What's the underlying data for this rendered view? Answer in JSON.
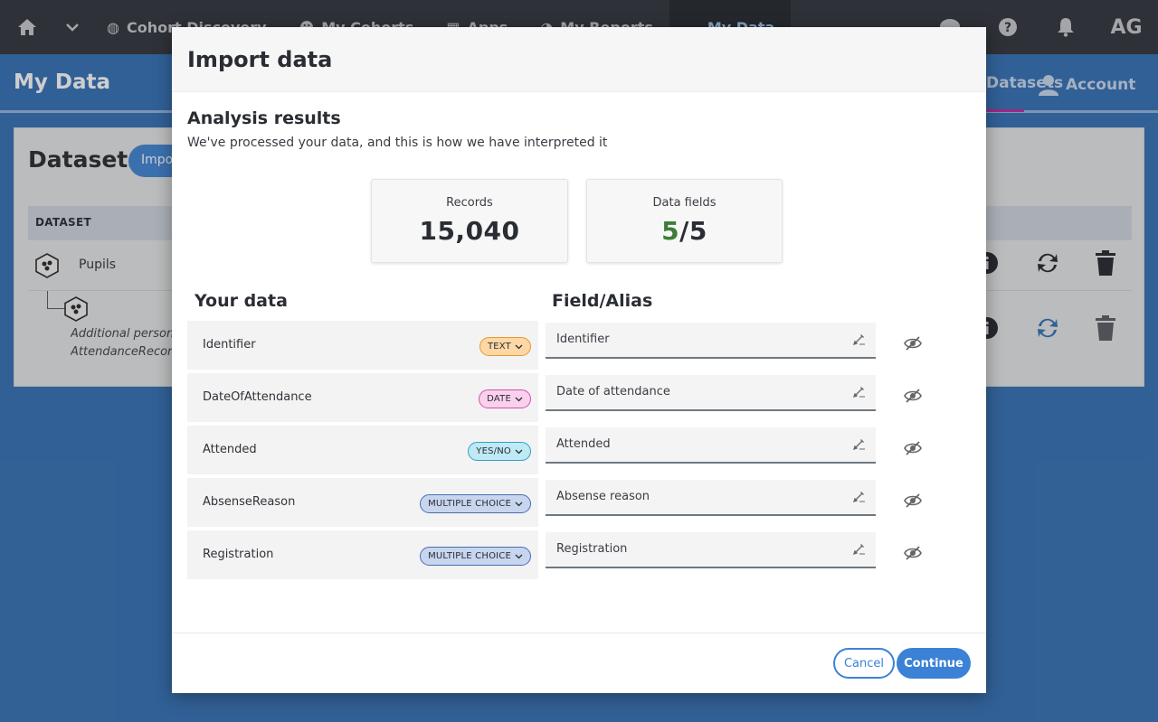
{
  "app": {
    "nav": {
      "items": [
        {
          "label": "Cohort Discovery",
          "icon": "cohort-icon"
        },
        {
          "label": "My Cohorts",
          "icon": "people-icon"
        },
        {
          "label": "Apps",
          "icon": "apps-icon"
        },
        {
          "label": "My Reports",
          "icon": "reports-icon"
        },
        {
          "label": "My Data",
          "icon": "cloud-icon",
          "active": true
        }
      ],
      "user_initials": "AG"
    },
    "subheader": {
      "title": "My Data",
      "tab_datasets": "Datasets",
      "tab_account": "Account"
    },
    "datasets": {
      "title": "Datasets",
      "import_button": "Import",
      "column_dataset": "DATASET",
      "row1_name": "Pupils",
      "row2_line1": "Additional person d",
      "row2_line2": "AttendanceRecords."
    }
  },
  "modal": {
    "title": "Import data",
    "analysis_title": "Analysis results",
    "analysis_subtitle": "We've processed your data, and this is how we have interpreted it",
    "records_label": "Records",
    "records_value": "15,040",
    "fields_label": "Data fields",
    "fields_found": "5",
    "fields_total": "/5",
    "col_your_data": "Your data",
    "col_field_alias": "Field/Alias",
    "rows": [
      {
        "field": "Identifier",
        "type": "TEXT",
        "alias": "Identifier"
      },
      {
        "field": "DateOfAttendance",
        "type": "DATE",
        "alias": "Date of attendance"
      },
      {
        "field": "Attended",
        "type": "YES/NO",
        "alias": "Attended"
      },
      {
        "field": "AbsenseReason",
        "type": "MULTIPLE CHOICE",
        "alias": "Absense reason"
      },
      {
        "field": "Registration",
        "type": "MULTIPLE CHOICE",
        "alias": "Registration"
      }
    ],
    "cancel_label": "Cancel",
    "continue_label": "Continue"
  },
  "colors": {
    "accent": "#3b82d6",
    "topnav": "#2a2e36",
    "page_bg": "#2e6db4",
    "green_count": "#3e7d3a",
    "pill_text": "#fdd7a5",
    "pill_date": "#fad1ec",
    "pill_yesno": "#bfe9f4",
    "pill_multi": "#c7d5ef"
  }
}
